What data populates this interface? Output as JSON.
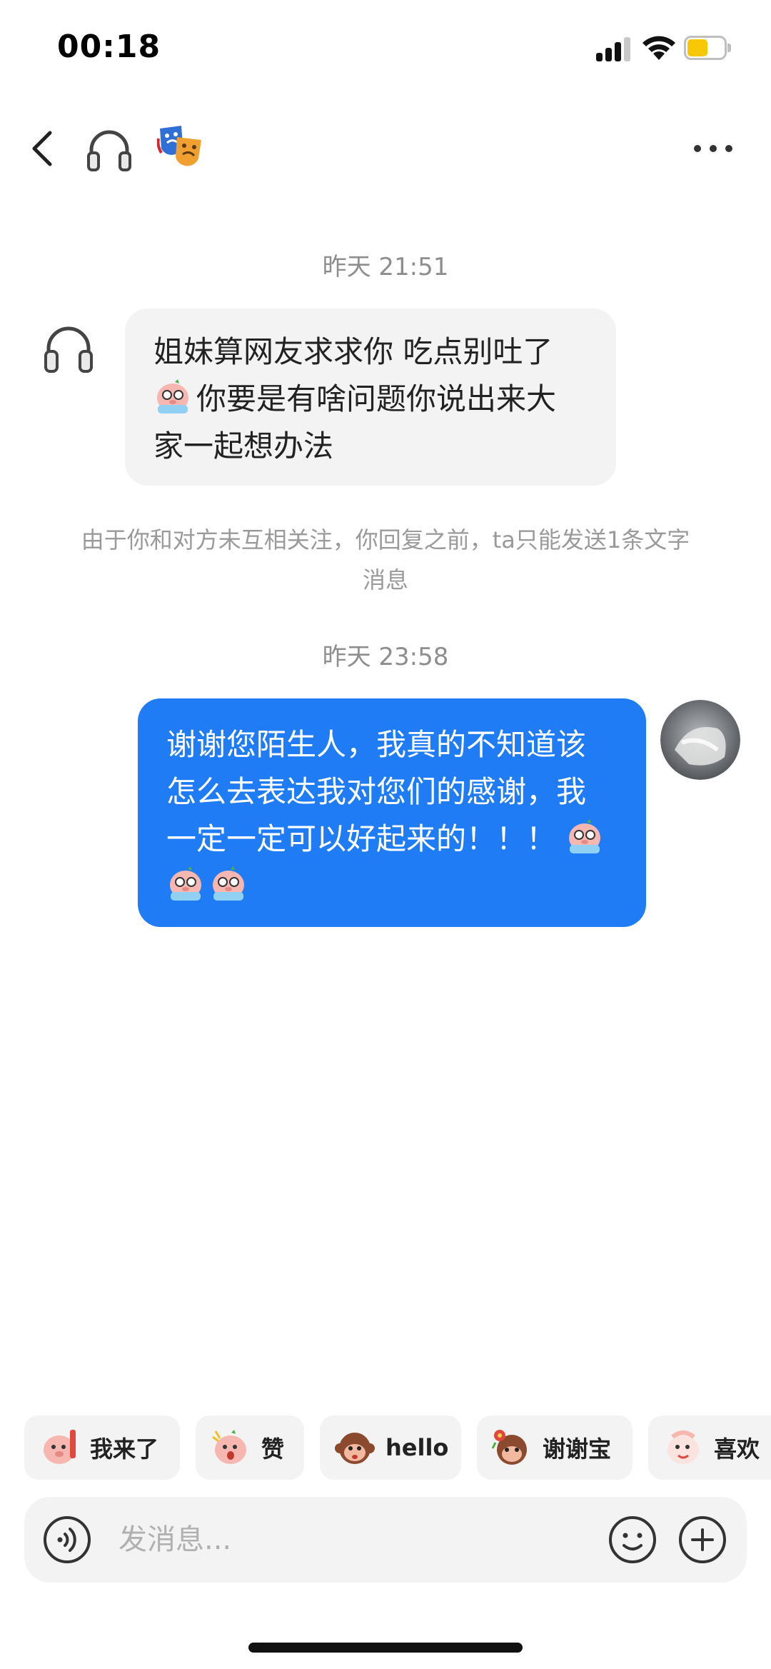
{
  "status_bar": {
    "time": "00:18",
    "battery_level": 0.55,
    "signal_bars": 3
  },
  "header": {
    "back_icon": "chevron-left-icon",
    "avatar_icon": "headphones-icon",
    "badge_icon": "performing-arts-masks-icon",
    "menu_icon": "more-horizontal-icon"
  },
  "messages": [
    {
      "timestamp": "昨天 21:51",
      "side": "left",
      "avatar_icon": "headphones-icon",
      "line1": "姐妹算网友求求你 吃点别吐了",
      "line2_emoji": "crying-pig-emoji",
      "line2": "你要是有啥问题你说出来大",
      "line3": "家一起想办法"
    },
    {
      "timestamp": "昨天 23:58",
      "side": "right",
      "avatar_icon": "user-avatar",
      "line1": "谢谢您陌生人，我真的不知道该",
      "line2": "怎么去表达我对您们的感谢，我",
      "line3": "一定一定可以好起来的！！！",
      "trailing_emojis": [
        "crying-pig-emoji",
        "crying-pig-emoji",
        "crying-pig-emoji"
      ]
    }
  ],
  "notice": {
    "line1": "由于你和对方未互相关注，你回复之前，ta只能发送1条文字",
    "line2": "消息"
  },
  "quick_replies": [
    {
      "label": "我来了",
      "icon": "pig-waving-emoji"
    },
    {
      "label": "赞",
      "icon": "pig-surprised-emoji"
    },
    {
      "label": "hello",
      "icon": "monkey-emoji"
    },
    {
      "label": "谢谢宝",
      "icon": "monkey-flower-emoji"
    },
    {
      "label": "喜欢",
      "icon": "pig-love-emoji"
    }
  ],
  "input": {
    "placeholder": "发消息...",
    "value": "",
    "voice_icon": "voice-icon",
    "emoji_icon": "smile-icon",
    "add_icon": "plus-icon"
  },
  "colors": {
    "accent": "#1f7cf4",
    "bubble_gray": "#f3f3f3",
    "timestamp_gray": "#8e8e8e",
    "battery": "#f8c805"
  }
}
